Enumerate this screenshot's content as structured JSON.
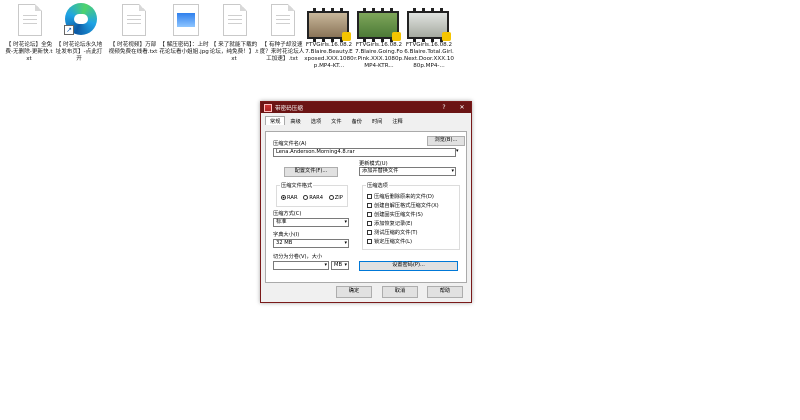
{
  "desktop": {
    "icons": [
      {
        "name": "txt1",
        "label": "【 时花论坛】全免费-无删除-更新快.txt"
      },
      {
        "name": "edge",
        "label": "【 时花论坛永久地址发布页】-点此打开"
      },
      {
        "name": "txt2",
        "label": "【 时花视频】万部视频免费在线看.txt"
      },
      {
        "name": "jpg",
        "label": "【 解压密码】：上时花论坛看小姐姐.jpg"
      },
      {
        "name": "txt3",
        "label": "【 来了就能下载的论坛，纯免费！】.txt"
      },
      {
        "name": "txt4",
        "label": "【 有种子却没速度？来时花论坛人工加速】.txt"
      },
      {
        "name": "vid1",
        "label": "FTVGirls.16.08.27.Blaire.Beauty.Exposed.XXX.1080p.MP4-KT..."
      },
      {
        "name": "vid2",
        "label": "FTVGirls.16.08.27.Blaire.Going.For.Pink.XXX.1080p.MP4-KTR..."
      },
      {
        "name": "vid3",
        "label": "FTVGirls.16.08.26.Blaire.Total.Girl.Next.Door.XXX.1080p.MP4-..."
      }
    ]
  },
  "dialog": {
    "title": "带密码压缩",
    "help_button": "?",
    "close_button": "✕",
    "tabs": [
      "常规",
      "高级",
      "选项",
      "文件",
      "备份",
      "时间",
      "注释"
    ],
    "browse_button": "浏览(B)...",
    "archive_name_label": "压缩文件名(A)",
    "archive_name_value": "Lena.Anderson.Morning4.8.rar",
    "update_mode_label": "更新模式(U)",
    "update_mode_value": "添加并替换文件",
    "profiles_button": "配置文件(F)...",
    "format_group": "压缩文件格式",
    "formats": [
      "RAR",
      "RAR4",
      "ZIP"
    ],
    "options_group": "压缩选项",
    "options": [
      "压缩后删除原来的文件(D)",
      "创建自解压格式压缩文件(X)",
      "创建固实压缩文件(S)",
      "添加恢复记录(E)",
      "测试压缩的文件(T)",
      "锁定压缩文件(L)"
    ],
    "method_label": "压缩方式(C)",
    "method_value": "标准",
    "dict_label": "字典大小(I)",
    "dict_value": "32 MB",
    "split_label": "切分为分卷(V)，大小",
    "split_value": "",
    "split_unit": "MB",
    "password_button": "设置密码(P)...",
    "ok_button": "确定",
    "cancel_button": "取消",
    "help_footer_button": "帮助"
  }
}
